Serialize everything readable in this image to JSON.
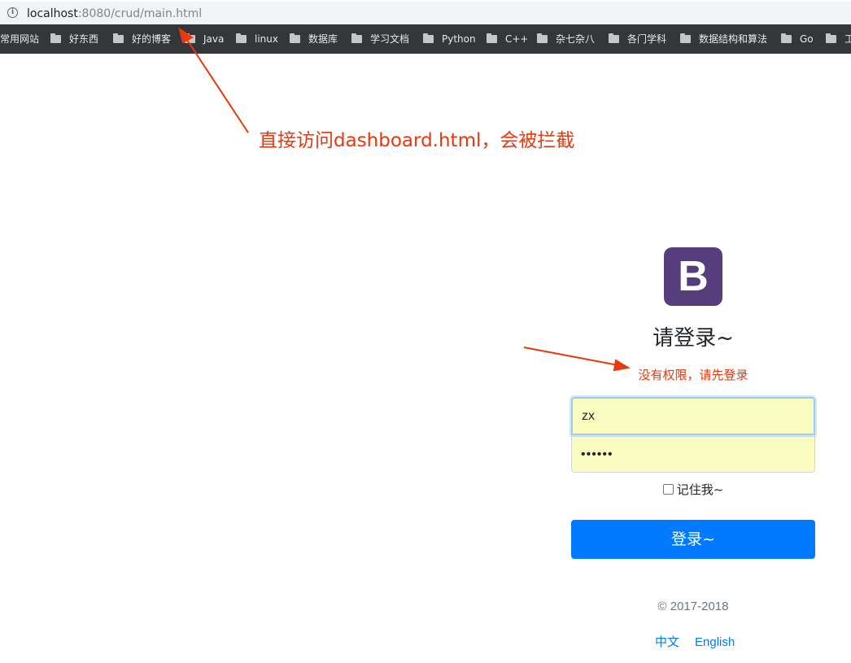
{
  "browser": {
    "url_host": "localhost",
    "url_rest": ":8080/crud/main.html",
    "bookmarks": [
      {
        "label": "常用网站",
        "folder": false
      },
      {
        "label": "好东西",
        "folder": true
      },
      {
        "label": "好的博客",
        "folder": true
      },
      {
        "label": "Java",
        "folder": true
      },
      {
        "label": "linux",
        "folder": true
      },
      {
        "label": "数据库",
        "folder": true
      },
      {
        "label": "学习文档",
        "folder": true
      },
      {
        "label": "Python",
        "folder": true
      },
      {
        "label": "C++",
        "folder": true
      },
      {
        "label": "杂七杂八",
        "folder": true
      },
      {
        "label": "各门学科",
        "folder": true
      },
      {
        "label": "数据结构和算法",
        "folder": true
      },
      {
        "label": "Go",
        "folder": true
      },
      {
        "label": "工",
        "folder": true
      }
    ]
  },
  "annotation": {
    "text": "直接访问dashboard.html，会被拦截",
    "color": "#e8380d"
  },
  "login": {
    "logo_letter": "B",
    "logo_color": "#563d7c",
    "heading": "请登录~",
    "error": "没有权限，请先登录",
    "username_value": "zx",
    "password_value": "••••••",
    "remember_label": "记住我~",
    "submit_label": "登录~",
    "button_color": "#007bff",
    "copyright": "© 2017-2018",
    "lang_zh": "中文",
    "lang_en": "English"
  }
}
